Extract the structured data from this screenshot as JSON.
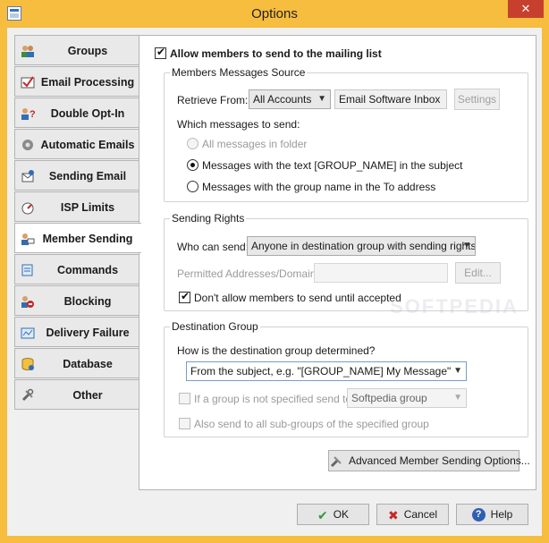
{
  "window": {
    "title": "Options",
    "close_glyph": "✕"
  },
  "tabs": [
    {
      "label": "Groups",
      "icon": "groups-icon",
      "active": false
    },
    {
      "label": "Email Processing",
      "icon": "email-processing-icon",
      "active": false
    },
    {
      "label": "Double Opt-In",
      "icon": "double-optin-icon",
      "active": false
    },
    {
      "label": "Automatic Emails",
      "icon": "automatic-emails-icon",
      "active": false
    },
    {
      "label": "Sending Email",
      "icon": "sending-email-icon",
      "active": false
    },
    {
      "label": "ISP Limits",
      "icon": "isp-limits-icon",
      "active": false
    },
    {
      "label": "Member Sending",
      "icon": "member-sending-icon",
      "active": true
    },
    {
      "label": "Commands",
      "icon": "commands-icon",
      "active": false
    },
    {
      "label": "Blocking",
      "icon": "blocking-icon",
      "active": false
    },
    {
      "label": "Delivery Failure",
      "icon": "delivery-failure-icon",
      "active": false
    },
    {
      "label": "Database",
      "icon": "database-icon",
      "active": false
    },
    {
      "label": "Other",
      "icon": "other-icon",
      "active": false
    }
  ],
  "allow_members": {
    "label": "Allow members to send to the mailing list",
    "checked": true
  },
  "source": {
    "title": "Members Messages Source",
    "retrieve_label": "Retrieve From:",
    "retrieve_value": "All Accounts",
    "account_value": "Email Software Inbox",
    "settings_label": "Settings",
    "which_label": "Which messages to send:",
    "options": [
      {
        "label": "All messages in folder",
        "selected": false,
        "disabled": true
      },
      {
        "label": "Messages with the text [GROUP_NAME] in the subject",
        "selected": true,
        "disabled": false
      },
      {
        "label": "Messages with the group name in the To address",
        "selected": false,
        "disabled": false
      }
    ]
  },
  "rights": {
    "title": "Sending Rights",
    "who_label": "Who can send:",
    "who_value": "Anyone in destination group with sending rights",
    "permitted_label": "Permitted Addresses/Domains:",
    "edit_label": "Edit...",
    "dont_allow_label": "Don't allow members to send until accepted",
    "dont_allow_checked": true
  },
  "destination": {
    "title": "Destination Group",
    "how_label": "How is the destination group determined?",
    "how_value": "From the subject, e.g. \"[GROUP_NAME] My Message\"",
    "if_label": "If a group is not specified send to:",
    "if_value": "Softpedia group",
    "subgroups_label": "Also send to all sub-groups of the specified group"
  },
  "advanced_label": "Advanced Member Sending Options...",
  "footer": {
    "ok_label": "OK",
    "cancel_label": "Cancel",
    "help_label": "Help"
  },
  "watermark": "SOFTPEDIA",
  "colors": {
    "title_bar": "#f6bd3e",
    "close_button": "#c7402d",
    "ok_icon": "#2e9a3a",
    "cancel_icon": "#c62828",
    "help_icon": "#2f5fb5"
  }
}
